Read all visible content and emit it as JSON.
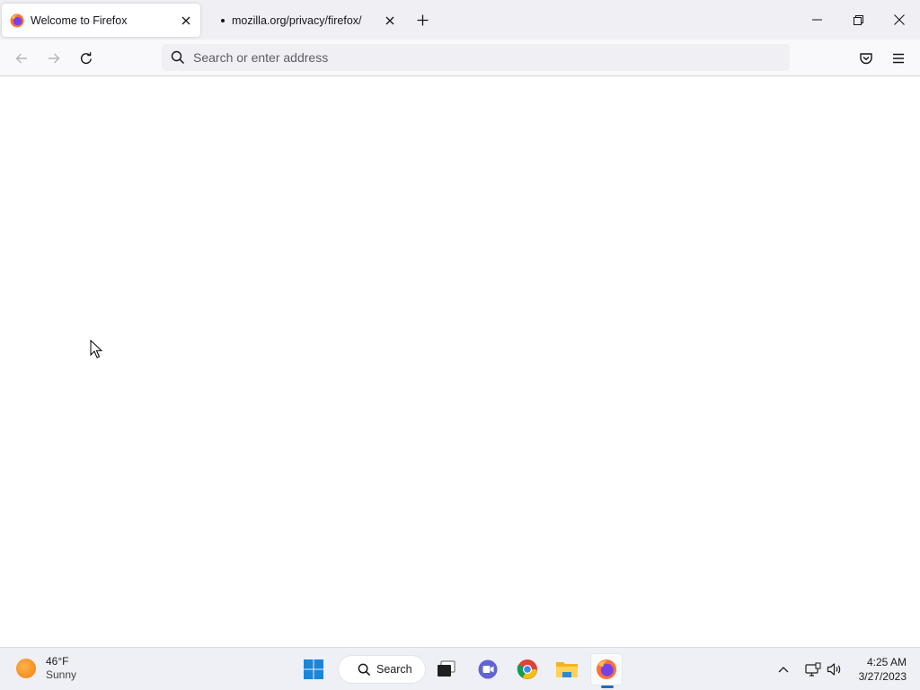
{
  "browser": {
    "tabs": [
      {
        "title": "Welcome to Firefox",
        "active": true
      },
      {
        "title": "mozilla.org/privacy/firefox/",
        "active": false
      }
    ],
    "urlbar": {
      "placeholder": "Search or enter address",
      "value": ""
    }
  },
  "taskbar": {
    "weather": {
      "temperature": "46°F",
      "condition": "Sunny"
    },
    "search_label": "Search",
    "clock": {
      "time": "4:25 AM",
      "date": "3/27/2023"
    }
  },
  "colors": {
    "tabstrip": "#f0f0f4",
    "navbar": "#f9f9fb",
    "taskbar": "#eef0f5",
    "taskbar_active_indicator": "#1f6fb8"
  }
}
